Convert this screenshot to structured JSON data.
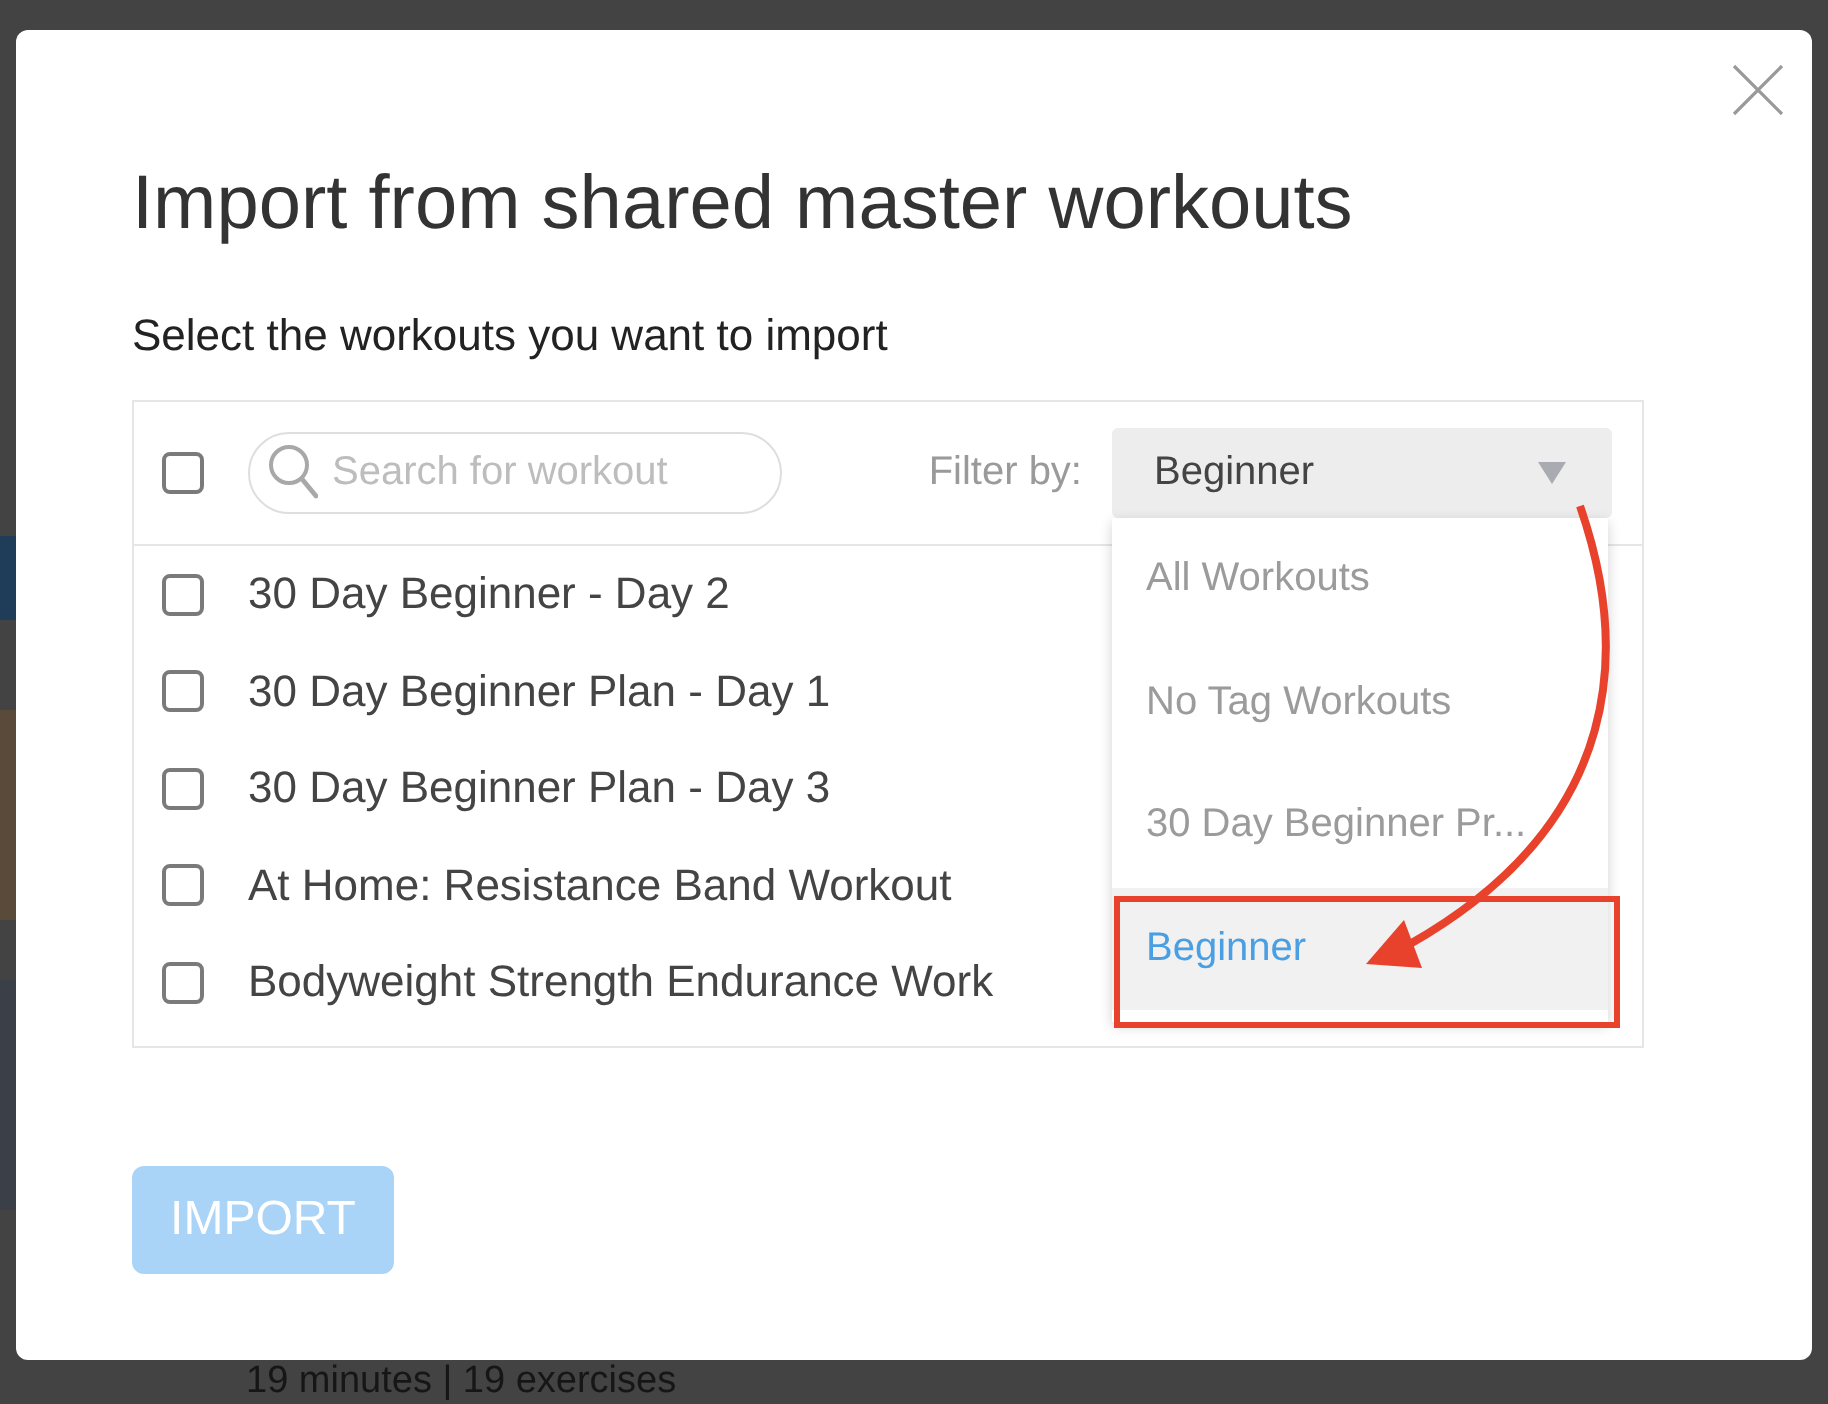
{
  "background": {
    "caption": "19 minutes | 19 exercises"
  },
  "dialog": {
    "title": "Import from shared master workouts",
    "subtitle": "Select the workouts you want to import"
  },
  "toolbar": {
    "select_all": {
      "checked": false
    },
    "search": {
      "placeholder": "Search for workout"
    },
    "filter_label": "Filter by:",
    "filter": {
      "value": "Beginner",
      "expanded": true,
      "options": [
        {
          "label": "All Workouts",
          "selected": false
        },
        {
          "label": "No Tag Workouts",
          "selected": false
        },
        {
          "label": "30 Day Beginner Pr...",
          "selected": false
        },
        {
          "label": "Beginner",
          "selected": true
        }
      ]
    }
  },
  "workouts": [
    {
      "name": "30 Day Beginner - Day 2",
      "checked": false
    },
    {
      "name": "30 Day Beginner Plan - Day 1",
      "checked": false
    },
    {
      "name": "30 Day Beginner Plan - Day 3",
      "checked": false
    },
    {
      "name": "At Home: Resistance Band Workout",
      "checked": false
    },
    {
      "name": "Bodyweight Strength Endurance Work",
      "checked": false
    }
  ],
  "import_button": {
    "label": "IMPORT",
    "disabled": true
  }
}
